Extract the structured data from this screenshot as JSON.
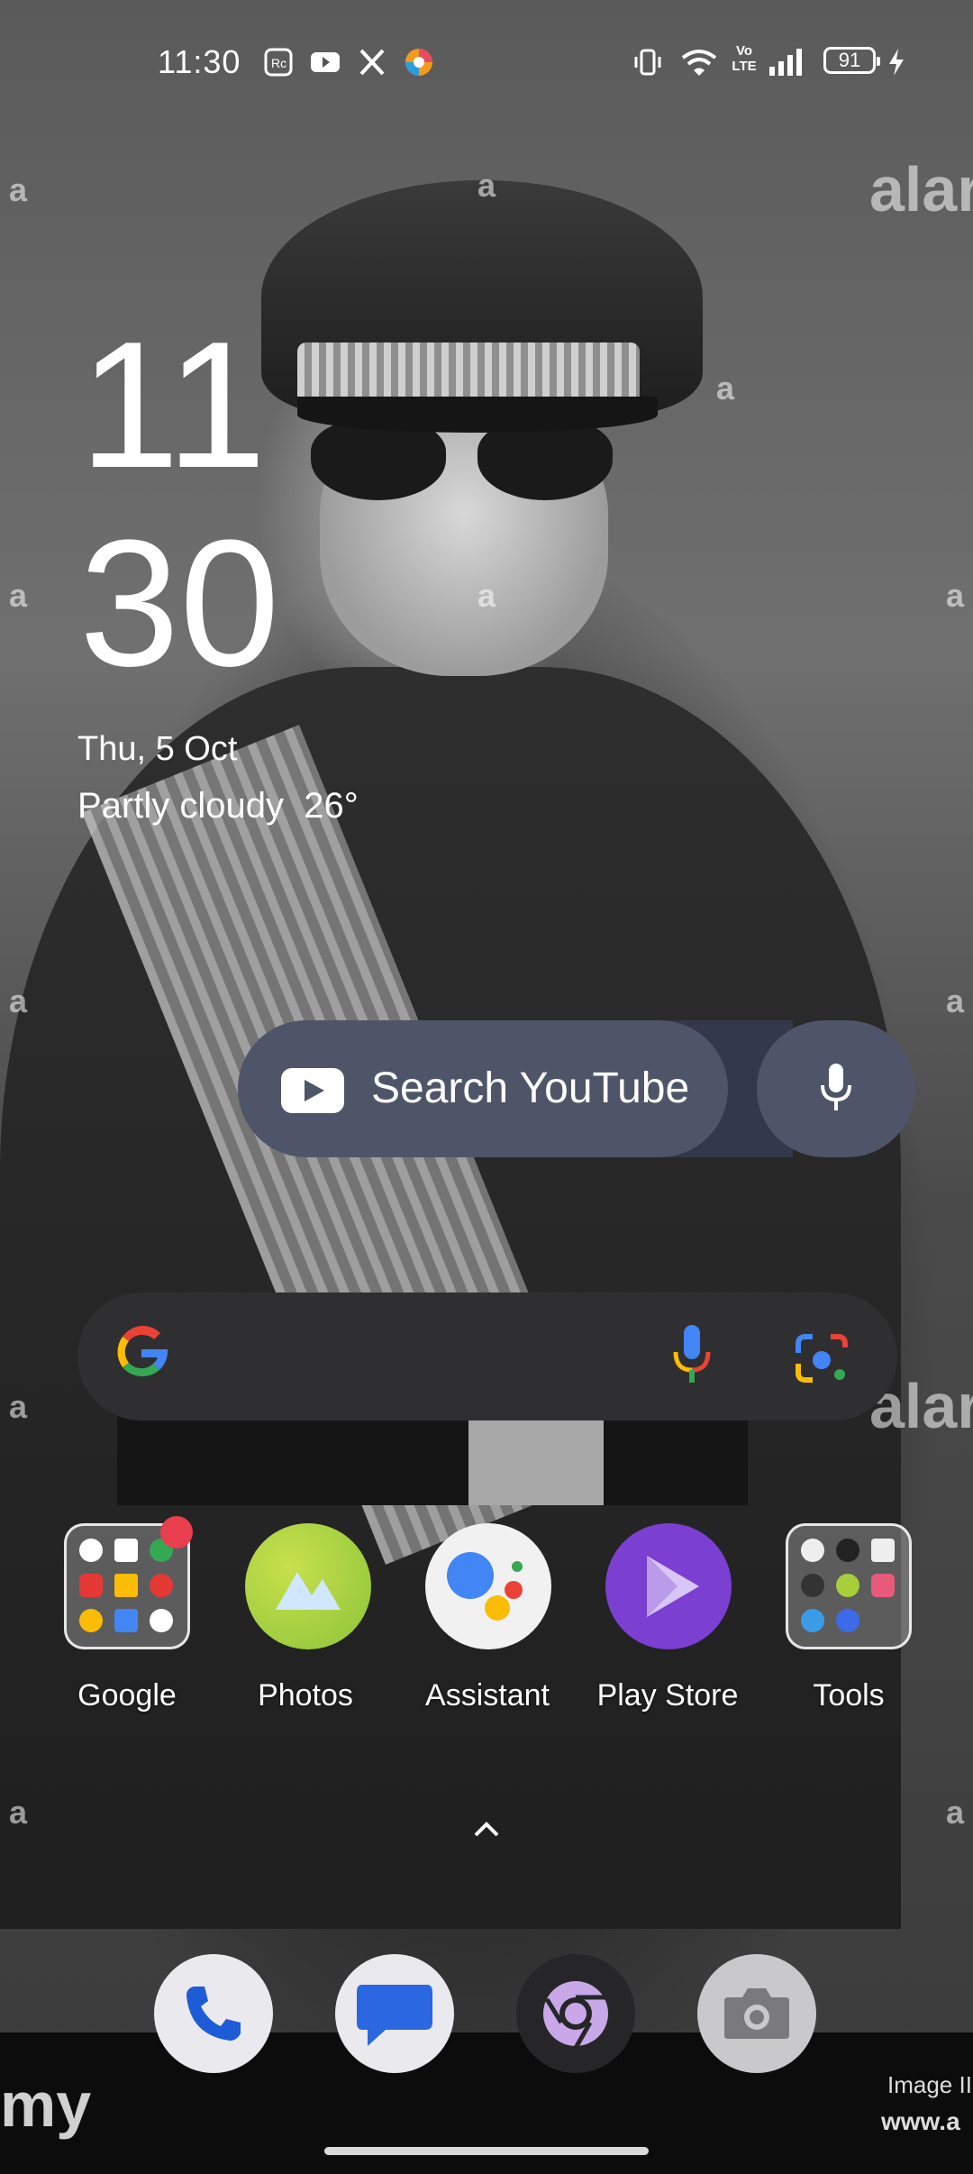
{
  "status_bar": {
    "time": "11:30",
    "notification_icons": [
      "screen-record-icon",
      "youtube-icon",
      "x-icon",
      "browser-icon"
    ],
    "system_icons": [
      "vibrate-icon",
      "wifi-icon",
      "volte-icon",
      "signal-icon",
      "battery-icon",
      "charging-icon"
    ],
    "volte_label": "Vo LTE",
    "battery_level": "91"
  },
  "clock_widget": {
    "hour": "11",
    "minute": "30",
    "date": "Thu, 5 Oct",
    "weather": "Partly cloudy  26°"
  },
  "youtube_widget": {
    "search_label": "Search YouTube"
  },
  "google_bar": {
    "icons": [
      "google-logo",
      "voice-search-icon",
      "google-lens-icon"
    ]
  },
  "apps": [
    {
      "label": "Google"
    },
    {
      "label": "Photos"
    },
    {
      "label": "Assistant"
    },
    {
      "label": "Play Store"
    },
    {
      "label": "Tools"
    }
  ],
  "dock": [
    "phone-icon",
    "messages-icon",
    "chrome-icon",
    "camera-icon"
  ],
  "wallpaper": {
    "watermark_texts": [
      "a",
      "alar",
      "my",
      "Image II",
      "www.a"
    ]
  },
  "colors": {
    "widget_pill": "#4f5568",
    "google_bar": "#2f2f31",
    "badge": "#e83e4e",
    "photos_green": "#a6cf3a",
    "play_purple": "#7b3fd1"
  }
}
